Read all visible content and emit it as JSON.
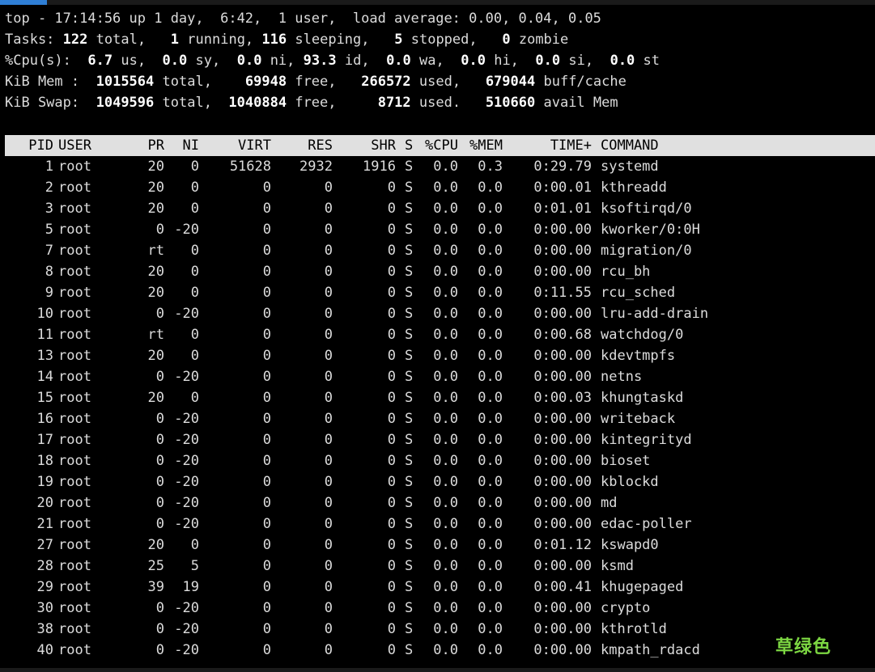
{
  "summary": {
    "line1": "top - 17:14:56 up 1 day,  6:42,  1 user,  load average: 0.00, 0.04, 0.05",
    "tasks": {
      "label": "Tasks:",
      "total": "122",
      "total_label": "total,",
      "running": "1",
      "running_label": "running,",
      "sleeping": "116",
      "sleeping_label": "sleeping,",
      "stopped": "5",
      "stopped_label": "stopped,",
      "zombie": "0",
      "zombie_label": "zombie"
    },
    "cpu": {
      "label": "%Cpu(s):",
      "us": "6.7",
      "us_label": "us,",
      "sy": "0.0",
      "sy_label": "sy,",
      "ni": "0.0",
      "ni_label": "ni,",
      "id": "93.3",
      "id_label": "id,",
      "wa": "0.0",
      "wa_label": "wa,",
      "hi": "0.0",
      "hi_label": "hi,",
      "si": "0.0",
      "si_label": "si,",
      "st": "0.0",
      "st_label": "st"
    },
    "mem": {
      "label": "KiB Mem :",
      "total": "1015564",
      "total_label": "total,",
      "free": "69948",
      "free_label": "free,",
      "used": "266572",
      "used_label": "used,",
      "buff": "679044",
      "buff_label": "buff/cache"
    },
    "swap": {
      "label": "KiB Swap:",
      "total": "1049596",
      "total_label": "total,",
      "free": "1040884",
      "free_label": "free,",
      "used": "8712",
      "used_label": "used.",
      "avail": "510660",
      "avail_label": "avail Mem"
    }
  },
  "table": {
    "headers": [
      "PID",
      "USER",
      "PR",
      "NI",
      "VIRT",
      "RES",
      "SHR",
      "S",
      "%CPU",
      "%MEM",
      "TIME+",
      "COMMAND"
    ],
    "rows": [
      [
        "1",
        "root",
        "20",
        "0",
        "51628",
        "2932",
        "1916",
        "S",
        "0.0",
        "0.3",
        "0:29.79",
        "systemd"
      ],
      [
        "2",
        "root",
        "20",
        "0",
        "0",
        "0",
        "0",
        "S",
        "0.0",
        "0.0",
        "0:00.01",
        "kthreadd"
      ],
      [
        "3",
        "root",
        "20",
        "0",
        "0",
        "0",
        "0",
        "S",
        "0.0",
        "0.0",
        "0:01.01",
        "ksoftirqd/0"
      ],
      [
        "5",
        "root",
        "0",
        "-20",
        "0",
        "0",
        "0",
        "S",
        "0.0",
        "0.0",
        "0:00.00",
        "kworker/0:0H"
      ],
      [
        "7",
        "root",
        "rt",
        "0",
        "0",
        "0",
        "0",
        "S",
        "0.0",
        "0.0",
        "0:00.00",
        "migration/0"
      ],
      [
        "8",
        "root",
        "20",
        "0",
        "0",
        "0",
        "0",
        "S",
        "0.0",
        "0.0",
        "0:00.00",
        "rcu_bh"
      ],
      [
        "9",
        "root",
        "20",
        "0",
        "0",
        "0",
        "0",
        "S",
        "0.0",
        "0.0",
        "0:11.55",
        "rcu_sched"
      ],
      [
        "10",
        "root",
        "0",
        "-20",
        "0",
        "0",
        "0",
        "S",
        "0.0",
        "0.0",
        "0:00.00",
        "lru-add-drain"
      ],
      [
        "11",
        "root",
        "rt",
        "0",
        "0",
        "0",
        "0",
        "S",
        "0.0",
        "0.0",
        "0:00.68",
        "watchdog/0"
      ],
      [
        "13",
        "root",
        "20",
        "0",
        "0",
        "0",
        "0",
        "S",
        "0.0",
        "0.0",
        "0:00.00",
        "kdevtmpfs"
      ],
      [
        "14",
        "root",
        "0",
        "-20",
        "0",
        "0",
        "0",
        "S",
        "0.0",
        "0.0",
        "0:00.00",
        "netns"
      ],
      [
        "15",
        "root",
        "20",
        "0",
        "0",
        "0",
        "0",
        "S",
        "0.0",
        "0.0",
        "0:00.03",
        "khungtaskd"
      ],
      [
        "16",
        "root",
        "0",
        "-20",
        "0",
        "0",
        "0",
        "S",
        "0.0",
        "0.0",
        "0:00.00",
        "writeback"
      ],
      [
        "17",
        "root",
        "0",
        "-20",
        "0",
        "0",
        "0",
        "S",
        "0.0",
        "0.0",
        "0:00.00",
        "kintegrityd"
      ],
      [
        "18",
        "root",
        "0",
        "-20",
        "0",
        "0",
        "0",
        "S",
        "0.0",
        "0.0",
        "0:00.00",
        "bioset"
      ],
      [
        "19",
        "root",
        "0",
        "-20",
        "0",
        "0",
        "0",
        "S",
        "0.0",
        "0.0",
        "0:00.00",
        "kblockd"
      ],
      [
        "20",
        "root",
        "0",
        "-20",
        "0",
        "0",
        "0",
        "S",
        "0.0",
        "0.0",
        "0:00.00",
        "md"
      ],
      [
        "21",
        "root",
        "0",
        "-20",
        "0",
        "0",
        "0",
        "S",
        "0.0",
        "0.0",
        "0:00.00",
        "edac-poller"
      ],
      [
        "27",
        "root",
        "20",
        "0",
        "0",
        "0",
        "0",
        "S",
        "0.0",
        "0.0",
        "0:01.12",
        "kswapd0"
      ],
      [
        "28",
        "root",
        "25",
        "5",
        "0",
        "0",
        "0",
        "S",
        "0.0",
        "0.0",
        "0:00.00",
        "ksmd"
      ],
      [
        "29",
        "root",
        "39",
        "19",
        "0",
        "0",
        "0",
        "S",
        "0.0",
        "0.0",
        "0:00.41",
        "khugepaged"
      ],
      [
        "30",
        "root",
        "0",
        "-20",
        "0",
        "0",
        "0",
        "S",
        "0.0",
        "0.0",
        "0:00.00",
        "crypto"
      ],
      [
        "38",
        "root",
        "0",
        "-20",
        "0",
        "0",
        "0",
        "S",
        "0.0",
        "0.0",
        "0:00.00",
        "kthrotld"
      ],
      [
        "40",
        "root",
        "0",
        "-20",
        "0",
        "0",
        "0",
        "S",
        "0.0",
        "0.0",
        "0:00.00",
        "kmpath_rdacd"
      ]
    ]
  },
  "watermark": "草绿色"
}
